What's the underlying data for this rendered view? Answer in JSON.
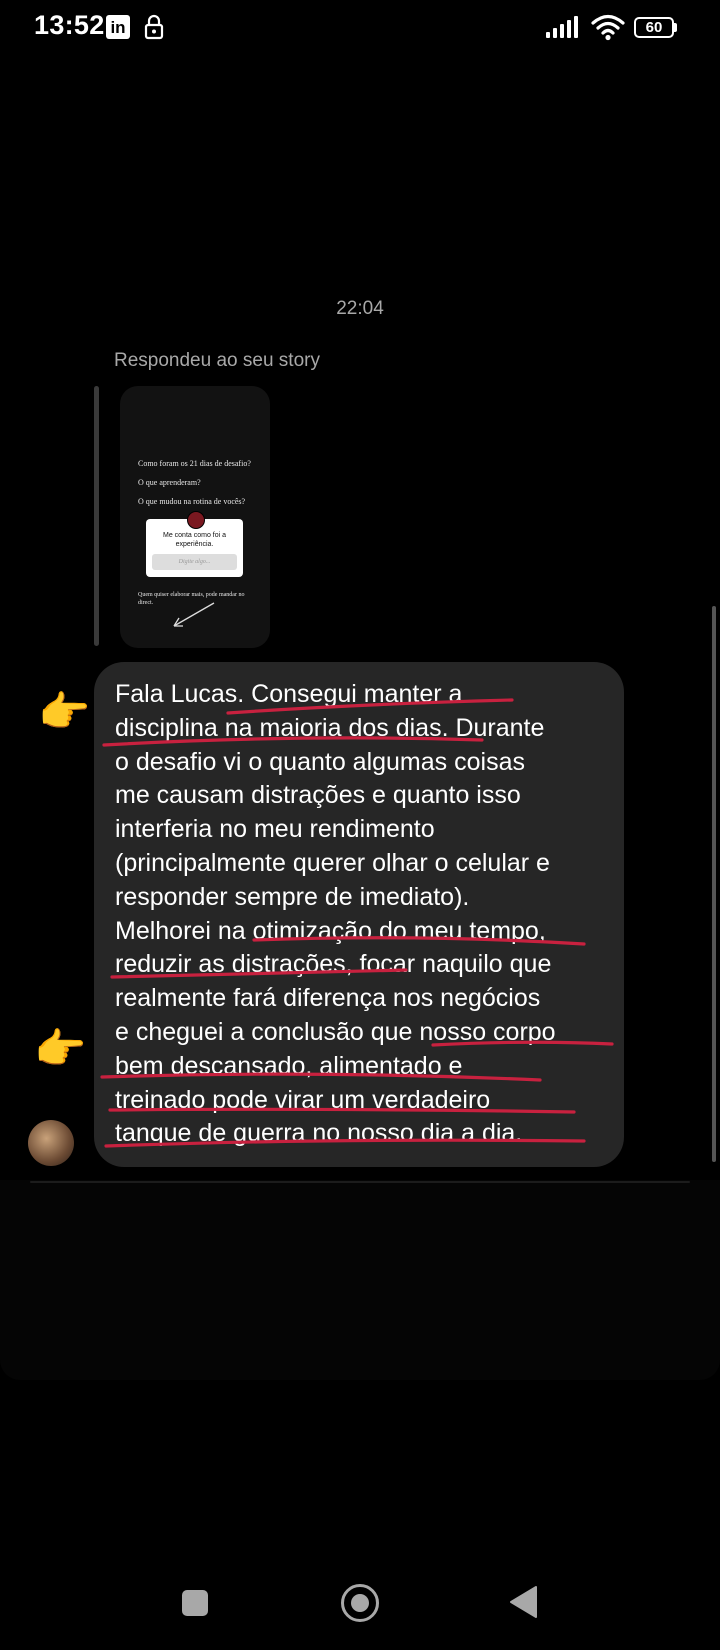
{
  "status_bar": {
    "time": "13:52",
    "app_icon": "linkedin-icon",
    "lock_icon": "lock-icon",
    "signal_icon": "signal-icon",
    "wifi_icon": "wifi-icon",
    "battery_percent": "60"
  },
  "chat": {
    "timestamp": "22:04",
    "reply_label": "Respondeu ao seu story",
    "story": {
      "lines": [
        "Como foram os 21 dias de desafio?",
        "O que aprenderam?",
        "O que mudou na rotina de vocês?"
      ],
      "question_box_text": "Me conta como foi a experiência.",
      "question_box_placeholder": "Digite algo...",
      "footer_text": "Quem quiser elaborar mais, pode mandar no direct."
    },
    "message": {
      "lines": [
        "Fala Lucas. Consegui manter a",
        "disciplina na maioria dos dias. Durante",
        "o desafio vi o quanto algumas coisas",
        "me causam distrações e quanto isso",
        "interferia no meu rendimento",
        "(principalmente querer olhar o celular e",
        "responder sempre de imediato).",
        "Melhorei na otimização do meu tempo,",
        "reduzir as distrações, focar naquilo que",
        "realmente fará diferença nos negócios",
        "e cheguei a conclusão que nosso corpo",
        "bem descansado, alimentado e",
        "treinado pode virar um verdadeiro",
        "tanque de guerra no nosso dia a dia."
      ],
      "highlight_color": "#c8213f",
      "annotation_icon": "pointing-hand-icon"
    }
  },
  "navigation": {
    "recent_icon": "square-icon",
    "home_icon": "home-circle-icon",
    "back_icon": "back-triangle-icon"
  },
  "colors": {
    "background": "#000000",
    "bubble": "#262626",
    "secondary_text": "#a8a8a8"
  }
}
